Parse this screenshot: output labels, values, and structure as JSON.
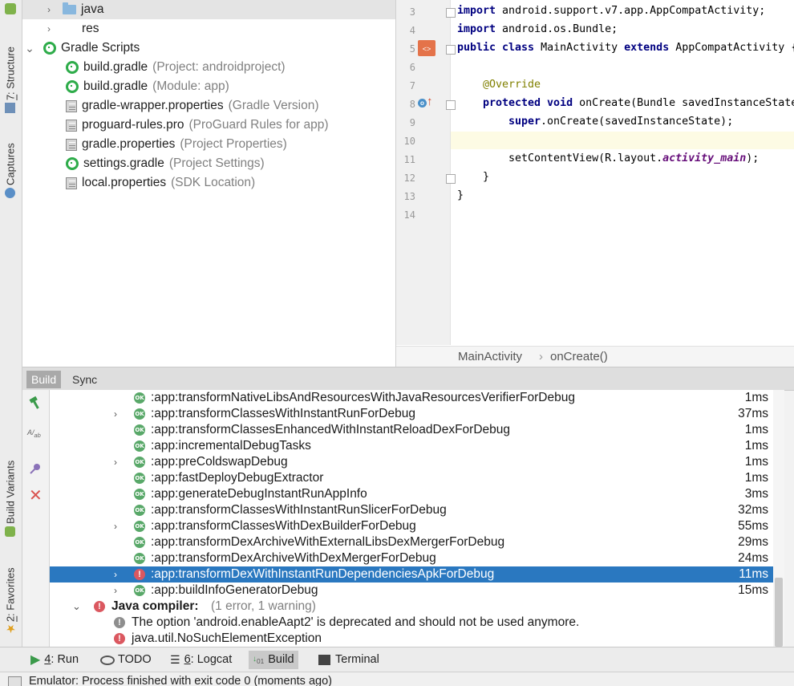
{
  "left_strip": {
    "structure_num": "7",
    "structure_label": ": Structure",
    "captures_label": "Captures",
    "build_variants_label": "Build Variants",
    "favorites_num": "2",
    "favorites_label": ": Favorites"
  },
  "project_tree": [
    {
      "label": "java",
      "hint": "",
      "icon": "folder-icon",
      "chevron": "›"
    },
    {
      "label": "res",
      "hint": "",
      "icon": "none",
      "chevron": "›"
    },
    {
      "label": "Gradle Scripts",
      "hint": "",
      "icon": "gradle-icon",
      "chevron": "⌄"
    },
    {
      "label": "build.gradle",
      "hint": "(Project: androidproject)",
      "icon": "gradle-icon"
    },
    {
      "label": "build.gradle",
      "hint": "(Module: app)",
      "icon": "gradle-icon"
    },
    {
      "label": "gradle-wrapper.properties",
      "hint": "(Gradle Version)",
      "icon": "properties-file-icon"
    },
    {
      "label": "proguard-rules.pro",
      "hint": "(ProGuard Rules for app)",
      "icon": "properties-file-icon"
    },
    {
      "label": "gradle.properties",
      "hint": "(Project Properties)",
      "icon": "properties-file-icon"
    },
    {
      "label": "settings.gradle",
      "hint": "(Project Settings)",
      "icon": "gradle-icon"
    },
    {
      "label": "local.properties",
      "hint": "(SDK Location)",
      "icon": "properties-file-icon"
    }
  ],
  "editor": {
    "line_numbers": [
      "3",
      "4",
      "5",
      "6",
      "7",
      "8",
      "9",
      "10",
      "11",
      "12",
      "13",
      "14"
    ],
    "code": {
      "l3_kw": "import",
      "l3_rest": " android.support.v7.app.AppCompatActivity;",
      "l4_kw": "import",
      "l4_rest": " android.os.Bundle;",
      "l5_kw1": "public class",
      "l5_mid": " MainActivity ",
      "l5_kw2": "extends",
      "l5_rest": " AppCompatActivity {",
      "l7_ann": "@Override",
      "l8_kw": "protected void",
      "l8_rest": " onCreate(Bundle savedInstanceState) {",
      "l9_kw": "super",
      "l9_rest": ".onCreate(savedInstanceState);",
      "l11_a": "setContentView(R.layout.",
      "l11_fld": "activity_main",
      "l11_b": ");",
      "l12": "}",
      "l13": "}"
    },
    "breadcrumb": {
      "class": "MainActivity",
      "sep": "›",
      "method": "onCreate()"
    }
  },
  "build_tabs": [
    "Build",
    "Sync"
  ],
  "build_rows": [
    {
      "task": ":app:transformNativeLibsAndResourcesWithJavaResourcesVerifierForDebug",
      "time": "1ms",
      "expand": false
    },
    {
      "task": ":app:transformClassesWithInstantRunForDebug",
      "time": "37ms",
      "expand": true
    },
    {
      "task": ":app:transformClassesEnhancedWithInstantReloadDexForDebug",
      "time": "1ms",
      "expand": false
    },
    {
      "task": ":app:incrementalDebugTasks",
      "time": "1ms",
      "expand": false
    },
    {
      "task": ":app:preColdswapDebug",
      "time": "1ms",
      "expand": true
    },
    {
      "task": ":app:fastDeployDebugExtractor",
      "time": "1ms",
      "expand": false
    },
    {
      "task": ":app:generateDebugInstantRunAppInfo",
      "time": "3ms",
      "expand": false
    },
    {
      "task": ":app:transformClassesWithInstantRunSlicerForDebug",
      "time": "32ms",
      "expand": false
    },
    {
      "task": ":app:transformClassesWithDexBuilderForDebug",
      "time": "55ms",
      "expand": true
    },
    {
      "task": ":app:transformDexArchiveWithExternalLibsDexMergerForDebug",
      "time": "29ms",
      "expand": false
    },
    {
      "task": ":app:transformDexArchiveWithDexMergerForDebug",
      "time": "24ms",
      "expand": false
    },
    {
      "task": ":app:transformDexWithInstantRunDependenciesApkForDebug",
      "time": "11ms",
      "expand": true,
      "error": true,
      "selected": true
    },
    {
      "task": ":app:buildInfoGeneratorDebug",
      "time": "15ms",
      "expand": true
    }
  ],
  "ok_badge": "OK",
  "java_compiler": {
    "label": "Java compiler:",
    "summary": "(1 error, 1 warning)"
  },
  "messages": [
    {
      "type": "warning",
      "text": "The option 'android.enableAapt2' is deprecated and should not be used anymore."
    },
    {
      "type": "error",
      "text": "java.util.NoSuchElementException"
    }
  ],
  "bottom_tabs": [
    {
      "num": "4",
      "label": ": Run",
      "icon": "run-icon"
    },
    {
      "num": "",
      "label": "TODO",
      "icon": "todo-icon"
    },
    {
      "num": "6",
      "label": ": Logcat",
      "icon": "logcat-icon"
    },
    {
      "num": "",
      "label": "Build",
      "icon": "build-icon",
      "active": true
    },
    {
      "num": "",
      "label": "Terminal",
      "icon": "terminal-icon"
    }
  ],
  "status": "Emulator: Process finished with exit code 0 (moments ago)",
  "colors": {
    "selection": "#2a78c0",
    "ok": "#59a869",
    "error": "#db5860",
    "keyword": "#000080"
  }
}
